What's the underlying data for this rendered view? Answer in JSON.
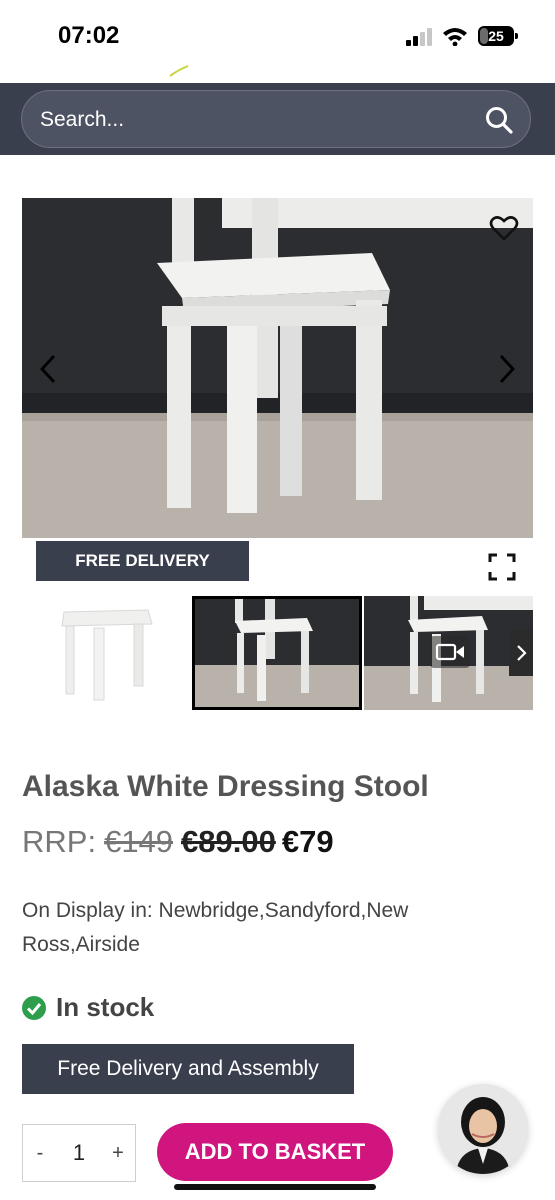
{
  "status_bar": {
    "time": "07:02",
    "battery": "25",
    "battery_level": 0.25
  },
  "search": {
    "placeholder": "Search..."
  },
  "gallery": {
    "badge": "FREE DELIVERY",
    "selected_thumbnail": 2
  },
  "product": {
    "title": "Alaska White Dressing Stool",
    "rrp_label": "RRP:",
    "rrp_value": "€149",
    "old_price": "€89.00",
    "sale_price": "€79",
    "display_in": "On Display in: Newbridge,Sandyford,New Ross,Airside",
    "stock": "In stock",
    "delivery_note": "Free Delivery and Assembly"
  },
  "cart": {
    "minus": "-",
    "quantity": "1",
    "plus": "+",
    "add_label": "ADD TO BASKET"
  },
  "colors": {
    "header_bg": "#3a3f4e",
    "accent_pink": "#d1157e",
    "in_stock_green": "#2e9e4c"
  }
}
